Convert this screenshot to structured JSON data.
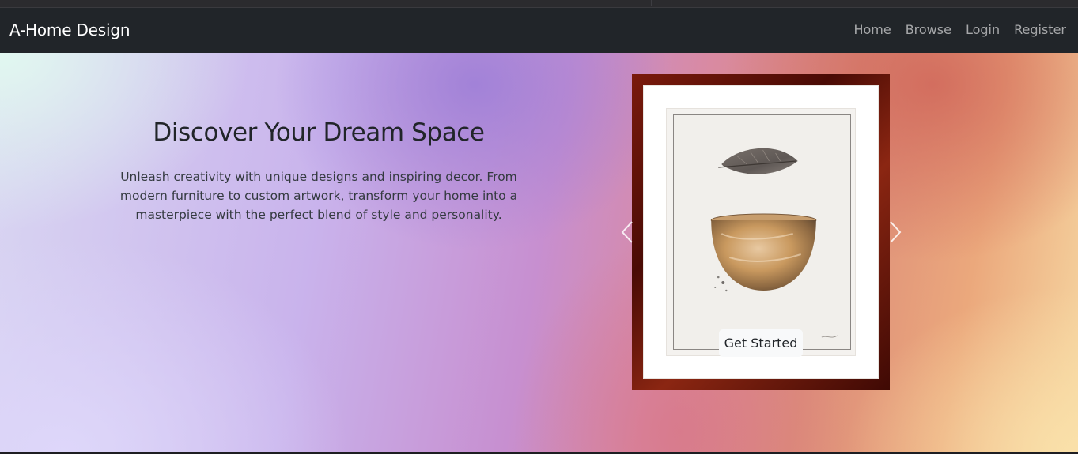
{
  "navbar": {
    "brand": "A-Home Design",
    "links": [
      "Home",
      "Browse",
      "Login",
      "Register"
    ]
  },
  "hero": {
    "title": "Discover Your Dream Space",
    "description": "Unleash creativity with unique designs and inspiring decor. From modern furniture to custom artwork, transform your home into a masterpiece with the perfect blend of style and personality."
  },
  "carousel": {
    "cta_label": "Get Started",
    "prev_icon": "chevron-left-icon",
    "next_icon": "chevron-right-icon"
  },
  "colors": {
    "navbar_bg": "#212529",
    "frame_wood": "#6a1408"
  }
}
